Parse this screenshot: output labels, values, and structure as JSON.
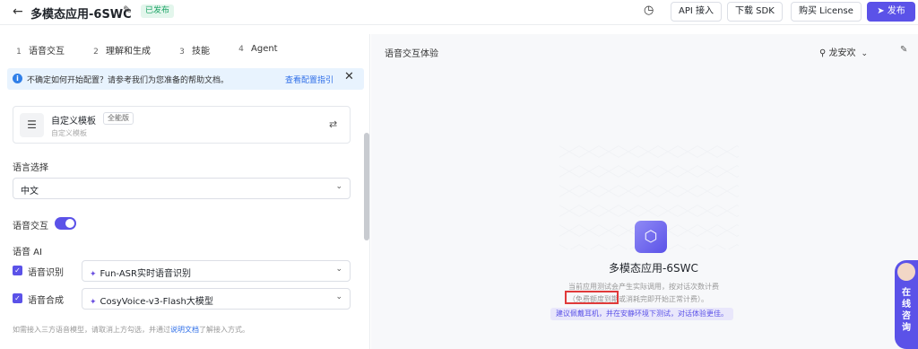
{
  "header": {
    "back_icon": "back-arrow-icon",
    "title": "多模态应用-6SWC",
    "status_badge": "已发布",
    "api_button": "API 接入",
    "sdk_button": "下载 SDK",
    "license_button": "购买 License",
    "publish_button": "发布"
  },
  "steps": [
    {
      "num": "1",
      "label": "语音交互"
    },
    {
      "num": "2",
      "label": "理解和生成"
    },
    {
      "num": "3",
      "label": "技能"
    },
    {
      "num": "4",
      "label": "Agent"
    }
  ],
  "tip": {
    "text": "不确定如何开始配置？请参考我们为您准备的帮助文档。",
    "link": "查看配置指引"
  },
  "template_card": {
    "name": "自定义模板",
    "chip": "全能版",
    "sub": "自定义模板"
  },
  "language": {
    "label": "语言选择",
    "value": "中文"
  },
  "voice": {
    "label": "语音交互",
    "enabled": true
  },
  "voice_ai": {
    "label": "语音 AI",
    "asr_label": "语音识别",
    "asr_model": "Fun-ASR实时语音识别",
    "tts_label": "语音合成",
    "tts_model": "CosyVoice-v3-Flash大模型"
  },
  "note": {
    "prefix": "如需接入三方语音模型，请取消上方勾选，并通过",
    "link": "说明文档",
    "suffix": "了解接入方式。"
  },
  "preview": {
    "title": "语音交互体验",
    "user": "龙安欢",
    "app_name": "多模态应用-6SWC",
    "desc1": "当前应用测试会产生实际调用，按对话次数计费",
    "desc2": "（免费额度到期或消耗完即开始正常计费）。",
    "hint": "建议佩戴耳机，并在安静环境下测试，对话体验更佳。"
  },
  "online_consult": "在线咨询",
  "colors": {
    "accent": "#5b52e8",
    "published": "#1aa364",
    "link": "#2f6fe8"
  }
}
